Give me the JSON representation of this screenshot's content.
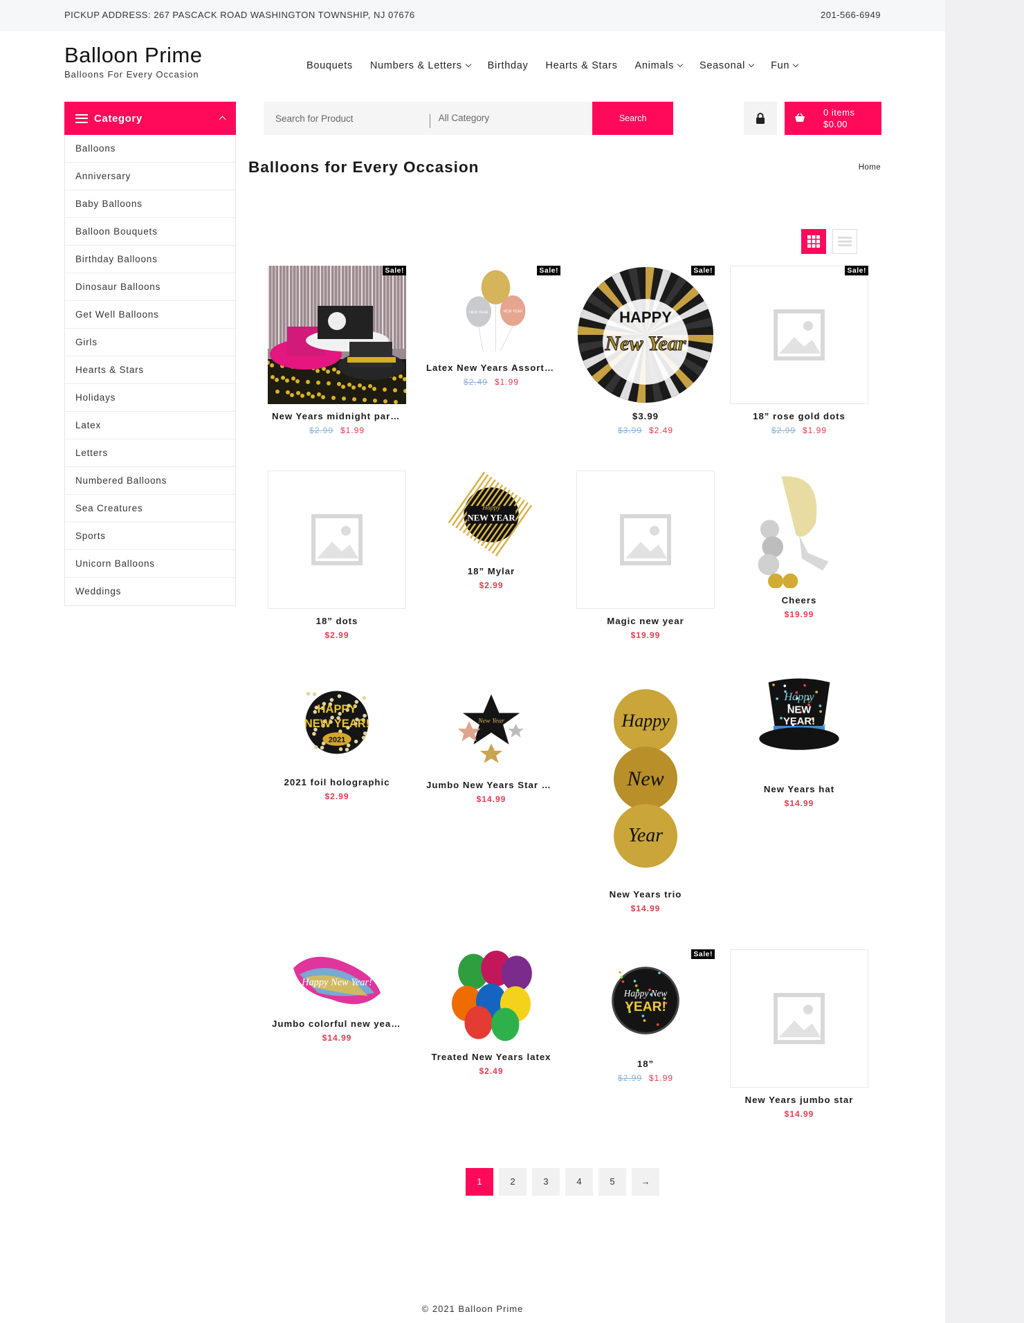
{
  "topbar": {
    "address": "PICKUP ADDRESS: 267 PASCACK ROAD WASHINGTON TOWNSHIP, NJ 07676",
    "phone": "201-566-6949"
  },
  "brand": {
    "name": "Balloon Prime",
    "tagline": "Balloons For Every Occasion"
  },
  "nav": {
    "items": [
      {
        "label": "Bouquets",
        "dropdown": false
      },
      {
        "label": "Numbers & Letters",
        "dropdown": true
      },
      {
        "label": "Birthday",
        "dropdown": false
      },
      {
        "label": "Hearts & Stars",
        "dropdown": false
      },
      {
        "label": "Animals",
        "dropdown": true
      },
      {
        "label": "Seasonal",
        "dropdown": true
      },
      {
        "label": "Fun",
        "dropdown": true
      }
    ]
  },
  "category": {
    "heading": "Category",
    "items": [
      "Balloons",
      "Anniversary",
      "Baby Balloons",
      "Balloon Bouquets",
      "Birthday Balloons",
      "Dinosaur Balloons",
      "Get Well Balloons",
      "Girls",
      "Hearts & Stars",
      "Holidays",
      "Latex",
      "Letters",
      "Numbered Balloons",
      "Sea Creatures",
      "Sports",
      "Unicorn Balloons",
      "Weddings"
    ]
  },
  "search": {
    "placeholder": "Search for Product",
    "category_select": "All Category",
    "button": "Search"
  },
  "cart": {
    "items": "0 items",
    "total": "$0.00"
  },
  "page": {
    "title": "Balloons for Every Occasion",
    "breadcrumb": "Home"
  },
  "products": [
    {
      "name": "New Years midnight party hats",
      "old": "$2.99",
      "price": "$1.99",
      "sale": "Sale!",
      "image": "party-hats-photo"
    },
    {
      "name": "Latex New Years Assortment",
      "old": "$2.49",
      "price": "$1.99",
      "sale": "Sale!",
      "image": "latex-balloon-trio"
    },
    {
      "name": "$3.99",
      "old": "$3.99",
      "price": "$2.49",
      "sale": "Sale!",
      "image": "happy-new-year-round-foil"
    },
    {
      "name": "18” rose gold dots",
      "old": "$2.99",
      "price": "$1.99",
      "sale": "Sale!",
      "image": "placeholder"
    },
    {
      "name": "18” dots",
      "price": "$2.99",
      "image": "placeholder"
    },
    {
      "name": "18” Mylar",
      "price": "$2.99",
      "image": "striped-new-year-foil"
    },
    {
      "name": "Magic new year",
      "price": "$19.99",
      "image": "placeholder"
    },
    {
      "name": "Cheers",
      "price": "$19.99",
      "image": "champagne-glass-balloon"
    },
    {
      "name": "2021 foil holographic",
      "price": "$2.99",
      "image": "2021-foil"
    },
    {
      "name": "Jumbo New Years Star cluster",
      "price": "$14.99",
      "image": "star-cluster"
    },
    {
      "name": "New Years trio",
      "price": "$14.99",
      "image": "gold-trio"
    },
    {
      "name": "New Years hat",
      "price": "$14.99",
      "image": "top-hat-balloon"
    },
    {
      "name": "Jumbo colorful new year banner",
      "price": "$14.99",
      "image": "colorful-banner"
    },
    {
      "name": "Treated New Years latex",
      "price": "$2.49",
      "image": "latex-bouquet"
    },
    {
      "name": "18”",
      "old": "$2.99",
      "price": "$1.99",
      "sale": "Sale!",
      "image": "black-new-year-foil"
    },
    {
      "name": "New Years jumbo star",
      "price": "$14.99",
      "image": "placeholder"
    }
  ],
  "pagination": [
    "1",
    "2",
    "3",
    "4",
    "5",
    "→"
  ],
  "footer": "© 2021 Balloon Prime",
  "colors": {
    "accent": "#ff0a5a",
    "old_price": "#8ab2d6",
    "price": "#e53a4e"
  }
}
